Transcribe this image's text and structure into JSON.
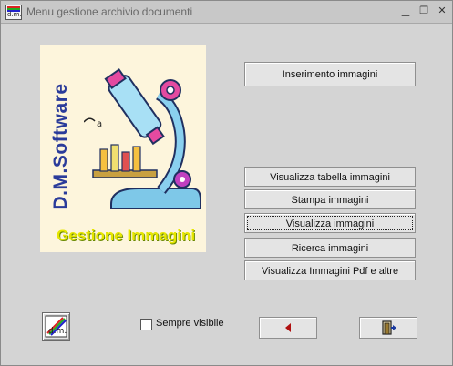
{
  "window": {
    "title": "Menu gestione archivio documenti",
    "minimize_glyph": "▁",
    "restore_glyph": "❐",
    "close_glyph": "✕"
  },
  "app_icon": {
    "name": "dm-software-icon",
    "text": "d.m."
  },
  "logo": {
    "side_text": "D.M.Software",
    "bottom_text": "Gestione Immagini",
    "illustration": "microscope-illustration"
  },
  "buttons": {
    "inserimento": "Inserimento immagini",
    "visualizza_tabella": "Visualizza tabella immagini",
    "stampa": "Stampa immagini",
    "visualizza": "Visualizza immagini",
    "ricerca": "Ricerca immagini",
    "visualizza_pdf": "Visualizza Immagini Pdf e altre"
  },
  "checkbox": {
    "label": "Sempre visibile",
    "checked": false
  },
  "nav": {
    "back_icon": "red-left-triangle-icon",
    "exit_icon": "door-exit-icon"
  },
  "colors": {
    "side_text": "#2a3b9a",
    "bottom_text": "#e6e600",
    "logo_bg": "#fdf5dc",
    "back_arrow": "#b01010"
  }
}
